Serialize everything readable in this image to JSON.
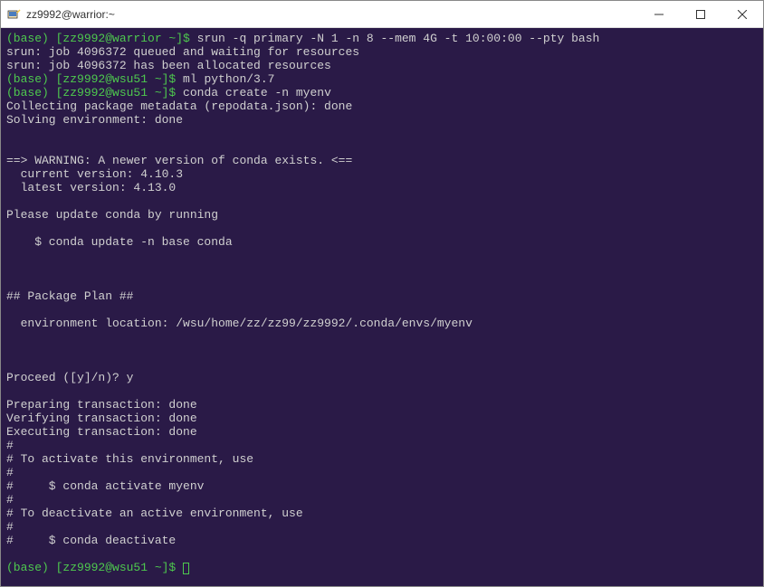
{
  "window": {
    "title": "zz9992@warrior:~"
  },
  "terminal": {
    "lines": [
      {
        "prompt": "(base) [zz9992@warrior ~]$ ",
        "text": "srun -q primary -N 1 -n 8 --mem 4G -t 10:00:00 --pty bash"
      },
      {
        "text": "srun: job 4096372 queued and waiting for resources"
      },
      {
        "text": "srun: job 4096372 has been allocated resources"
      },
      {
        "prompt": "(base) [zz9992@wsu51 ~]$ ",
        "text": "ml python/3.7"
      },
      {
        "prompt": "(base) [zz9992@wsu51 ~]$ ",
        "text": "conda create -n myenv"
      },
      {
        "text": "Collecting package metadata (repodata.json): done"
      },
      {
        "text": "Solving environment: done"
      },
      {
        "text": ""
      },
      {
        "text": ""
      },
      {
        "text": "==> WARNING: A newer version of conda exists. <=="
      },
      {
        "text": "  current version: 4.10.3"
      },
      {
        "text": "  latest version: 4.13.0"
      },
      {
        "text": ""
      },
      {
        "text": "Please update conda by running"
      },
      {
        "text": ""
      },
      {
        "text": "    $ conda update -n base conda"
      },
      {
        "text": ""
      },
      {
        "text": ""
      },
      {
        "text": ""
      },
      {
        "text": "## Package Plan ##"
      },
      {
        "text": ""
      },
      {
        "text": "  environment location: /wsu/home/zz/zz99/zz9992/.conda/envs/myenv"
      },
      {
        "text": ""
      },
      {
        "text": ""
      },
      {
        "text": ""
      },
      {
        "text": "Proceed ([y]/n)? y"
      },
      {
        "text": ""
      },
      {
        "text": "Preparing transaction: done"
      },
      {
        "text": "Verifying transaction: done"
      },
      {
        "text": "Executing transaction: done"
      },
      {
        "text": "#"
      },
      {
        "text": "# To activate this environment, use"
      },
      {
        "text": "#"
      },
      {
        "text": "#     $ conda activate myenv"
      },
      {
        "text": "#"
      },
      {
        "text": "# To deactivate an active environment, use"
      },
      {
        "text": "#"
      },
      {
        "text": "#     $ conda deactivate"
      },
      {
        "text": ""
      },
      {
        "prompt": "(base) [zz9992@wsu51 ~]$ ",
        "text": "",
        "cursor": true
      }
    ]
  }
}
